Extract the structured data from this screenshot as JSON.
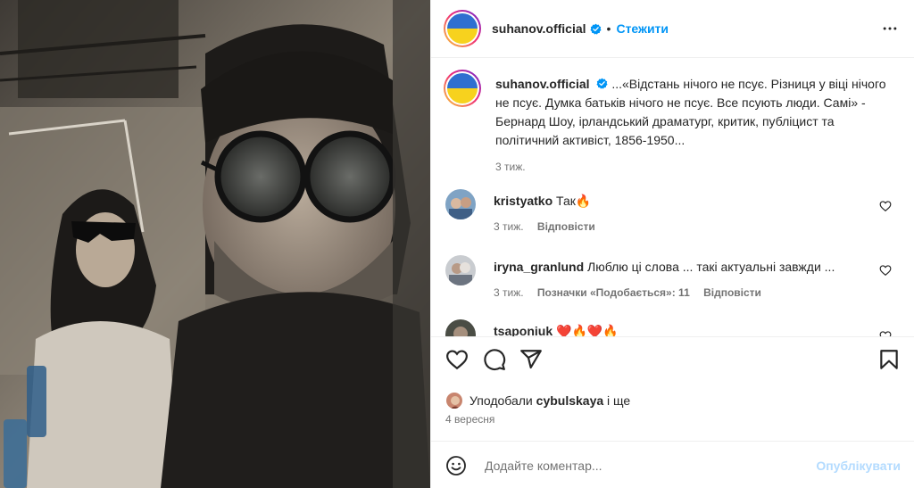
{
  "post": {
    "username": "suhanov.official",
    "follow_label": "Стежити",
    "dot": "•",
    "caption_username": "suhanov.official",
    "caption_text": "...«Відстань нічого не псує. Різниця у віці нічого не псує. Думка батьків нічого не псує. Все псують люди. Самі» - Бернард Шоу, ірландський драматург, критик, публіцист та політичний активіст, 1856-1950...",
    "caption_time": "3 тиж."
  },
  "comments": [
    {
      "username": "kristyatko",
      "text": "Так🔥",
      "time": "3 тиж.",
      "reply": "Відповісти"
    },
    {
      "username": "iryna_granlund",
      "text": "Люблю ці слова ... такі актуальні завжди ...",
      "time": "3 тиж.",
      "likes_label": "Позначки «Подобається»: 11",
      "reply": "Відповісти"
    },
    {
      "username": "tsaponiuk",
      "text": "❤️🔥❤️🔥"
    }
  ],
  "likes": {
    "prefix": "Уподобали",
    "user": "cybulskaya",
    "suffix": "і ще"
  },
  "date": "4 вересня",
  "add_comment": {
    "placeholder": "Додайте коментар...",
    "publish": "Опублікувати"
  },
  "colors": {
    "accent": "#0095f6",
    "publish_disabled": "#b3dbff",
    "flag_blue": "#2f6fd0",
    "flag_yellow": "#f7d21e"
  },
  "icons": [
    "verified-badge-icon",
    "more-options-icon",
    "heart-icon",
    "comment-icon",
    "share-icon",
    "bookmark-icon",
    "emoji-icon"
  ]
}
